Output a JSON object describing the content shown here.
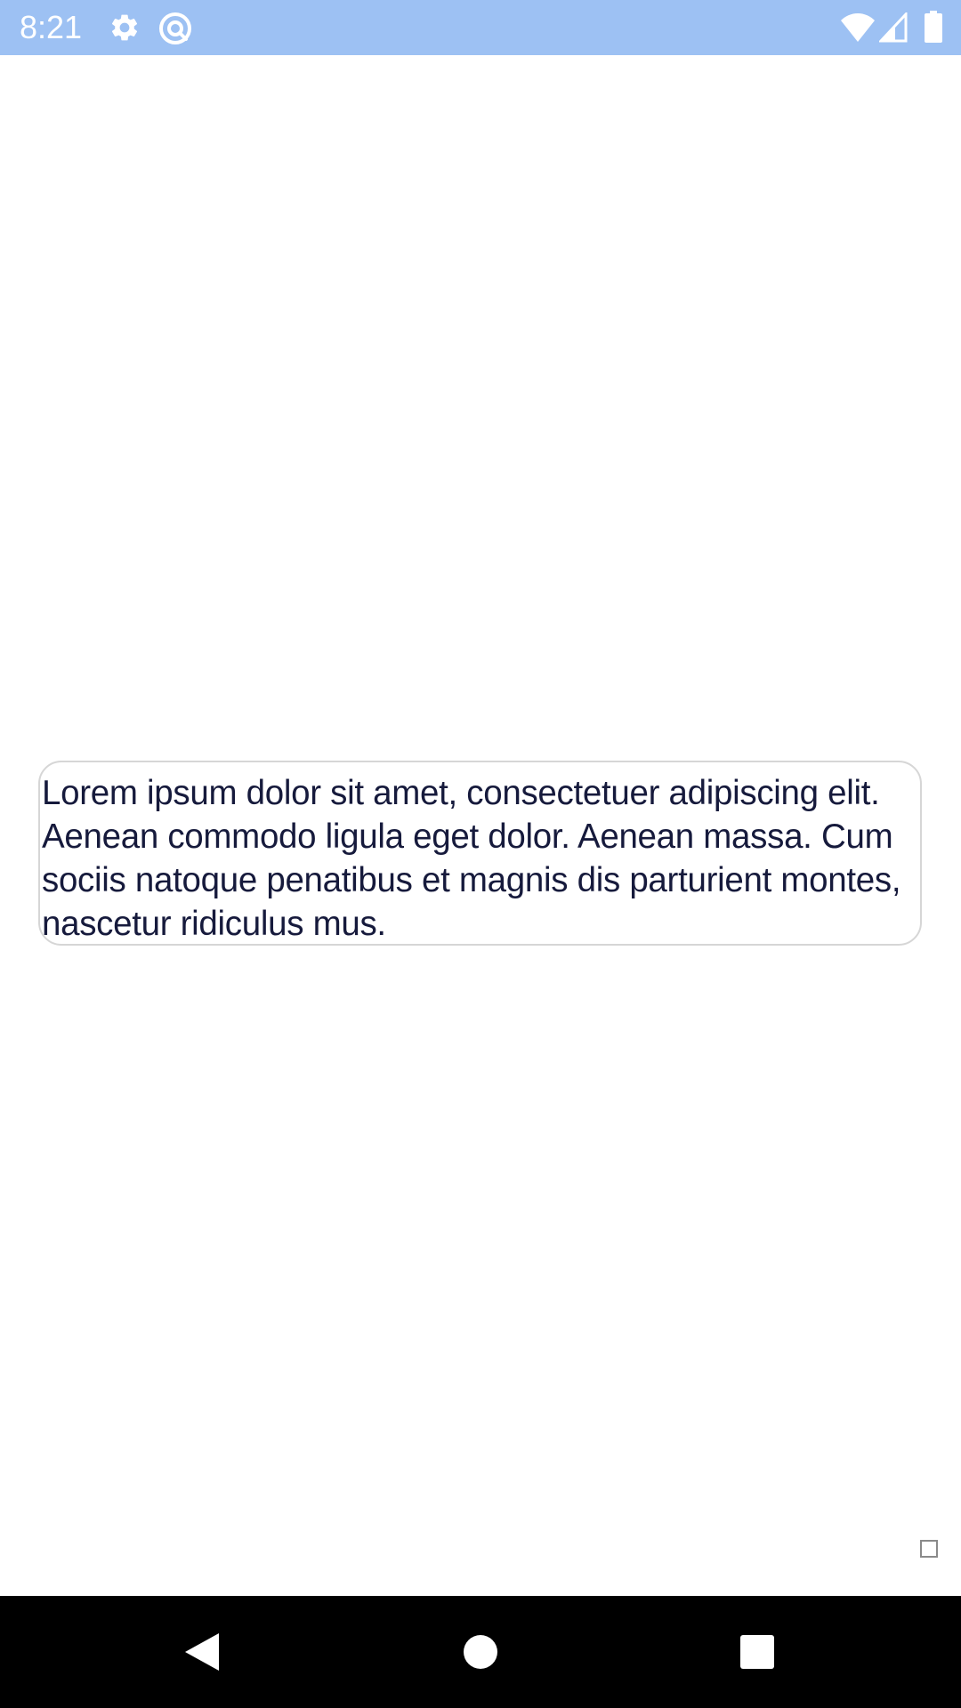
{
  "status_bar": {
    "time": "8:21",
    "background_color": "#9dc1f3",
    "icons": {
      "left": [
        "gear-icon",
        "at-sign-icon"
      ],
      "right": [
        "wifi-icon",
        "cell-signal-icon",
        "battery-icon"
      ]
    }
  },
  "main": {
    "text_box": {
      "text": "Lorem ipsum dolor sit amet, consectetuer adipiscing elit. Aenean commodo ligula eget dolor. Aenean massa. Cum sociis natoque penatibus et magnis dis parturient montes, nascetur ridiculus mus."
    }
  },
  "navigation_bar": {
    "buttons": [
      "back-icon",
      "home-icon",
      "recents-icon"
    ]
  }
}
